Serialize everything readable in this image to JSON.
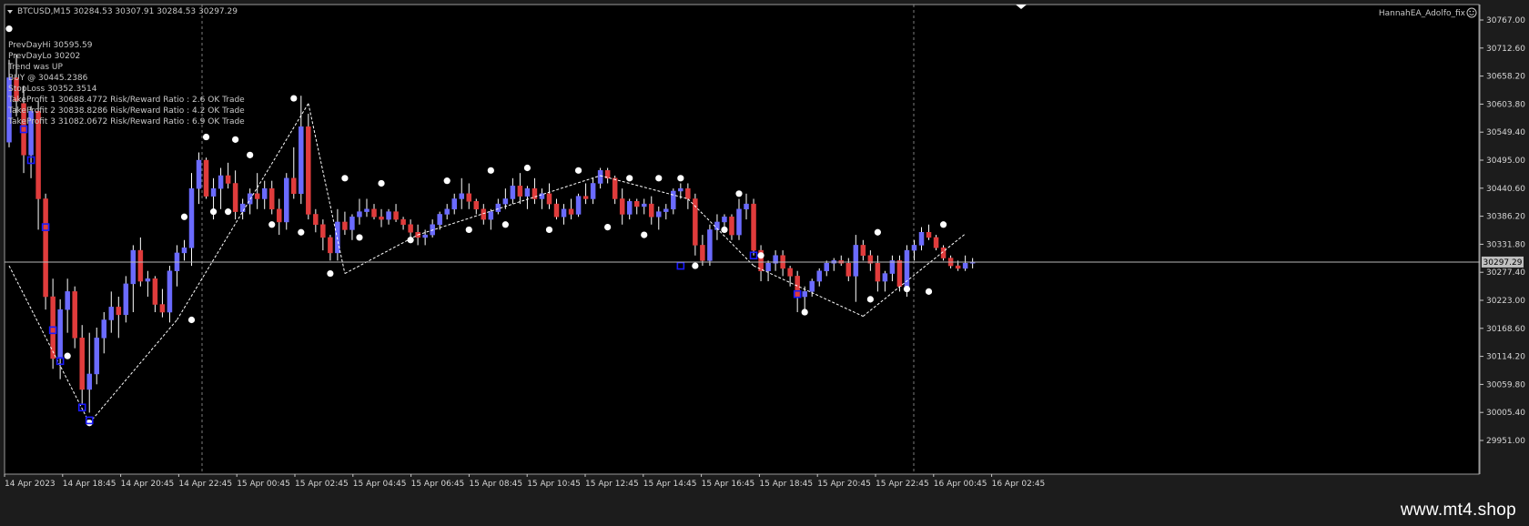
{
  "chart": {
    "symbol_header": "BTCUSD,M15  30284.53 30307.91 30284.53 30297.29",
    "ea_label": "HannahEA_Adolfo_fix",
    "current_price": "30297.29",
    "info_lines": [
      "PrevDayHi 30595.59",
      "PrevDayLo 30202",
      "Trend was UP",
      "BUY @ 30445.2386",
      "StopLoss 30352.3514",
      "TakeProfit 1 30688.4772 Risk/Reward Ratio : 2.6 OK Trade",
      "TakeProfit 2 30838.8286 Risk/Reward Ratio : 4.2 OK Trade",
      "TakeProfit 3 31082.0672 Risk/Reward Ratio : 6.9 OK Trade"
    ],
    "price_ticks": [
      "30767.00",
      "30712.60",
      "30658.20",
      "30603.80",
      "30549.40",
      "30495.00",
      "30440.60",
      "30386.20",
      "30331.80",
      "30277.40",
      "30223.00",
      "30168.60",
      "30114.20",
      "30059.80",
      "30005.40",
      "29951.00"
    ],
    "time_ticks": [
      "14 Apr 2023",
      "14 Apr 18:45",
      "14 Apr 20:45",
      "14 Apr 22:45",
      "15 Apr 00:45",
      "15 Apr 02:45",
      "15 Apr 04:45",
      "15 Apr 06:45",
      "15 Apr 08:45",
      "15 Apr 10:45",
      "15 Apr 12:45",
      "15 Apr 14:45",
      "15 Apr 16:45",
      "15 Apr 18:45",
      "15 Apr 20:45",
      "15 Apr 22:45",
      "16 Apr 00:45",
      "16 Apr 02:45"
    ],
    "colors": {
      "bull": "#6b6bff",
      "bear": "#e03c3c",
      "background": "#000000",
      "grid": "#9a9a9a",
      "zigzag": "#ffffff",
      "marker": "#1a1aff"
    }
  },
  "chart_data": {
    "type": "candlestick",
    "y_range": [
      29951.0,
      30767.0
    ],
    "candles": [
      [
        30530,
        30690,
        30520,
        30655
      ],
      [
        30655,
        30700,
        30580,
        30610
      ],
      [
        30605,
        30640,
        30470,
        30505
      ],
      [
        30505,
        30600,
        30460,
        30590
      ],
      [
        30590,
        30610,
        30360,
        30420
      ],
      [
        30420,
        30430,
        30205,
        30230
      ],
      [
        30230,
        30265,
        30090,
        30110
      ],
      [
        30110,
        30225,
        30070,
        30205
      ],
      [
        30205,
        30265,
        30160,
        30240
      ],
      [
        30240,
        30250,
        30130,
        30150
      ],
      [
        30150,
        30175,
        30020,
        30050
      ],
      [
        30050,
        30160,
        30005,
        30080
      ],
      [
        30080,
        30170,
        30060,
        30150
      ],
      [
        30150,
        30200,
        30120,
        30185
      ],
      [
        30185,
        30240,
        30160,
        30210
      ],
      [
        30210,
        30230,
        30150,
        30195
      ],
      [
        30195,
        30270,
        30180,
        30255
      ],
      [
        30255,
        30330,
        30200,
        30320
      ],
      [
        30320,
        30345,
        30250,
        30260
      ],
      [
        30260,
        30280,
        30230,
        30265
      ],
      [
        30265,
        30270,
        30200,
        30215
      ],
      [
        30215,
        30245,
        30190,
        30200
      ],
      [
        30200,
        30290,
        30180,
        30280
      ],
      [
        30280,
        30330,
        30250,
        30315
      ],
      [
        30315,
        30340,
        30300,
        30325
      ],
      [
        30325,
        30470,
        30290,
        30440
      ],
      [
        30440,
        30510,
        30410,
        30495
      ],
      [
        30495,
        30500,
        30420,
        30425
      ],
      [
        30425,
        30460,
        30380,
        30440
      ],
      [
        30440,
        30480,
        30400,
        30465
      ],
      [
        30465,
        30490,
        30440,
        30450
      ],
      [
        30450,
        30475,
        30380,
        30395
      ],
      [
        30395,
        30420,
        30380,
        30410
      ],
      [
        30410,
        30440,
        30390,
        30430
      ],
      [
        30430,
        30470,
        30400,
        30420
      ],
      [
        30420,
        30455,
        30400,
        30440
      ],
      [
        30440,
        30455,
        30390,
        30400
      ],
      [
        30400,
        30420,
        30350,
        30375
      ],
      [
        30375,
        30470,
        30360,
        30460
      ],
      [
        30460,
        30520,
        30420,
        30430
      ],
      [
        30430,
        30620,
        30410,
        30560
      ],
      [
        30560,
        30585,
        30380,
        30390
      ],
      [
        30390,
        30400,
        30355,
        30370
      ],
      [
        30370,
        30380,
        30320,
        30345
      ],
      [
        30345,
        30350,
        30300,
        30315
      ],
      [
        30315,
        30400,
        30300,
        30375
      ],
      [
        30375,
        30395,
        30350,
        30360
      ],
      [
        30360,
        30390,
        30340,
        30385
      ],
      [
        30385,
        30420,
        30370,
        30395
      ],
      [
        30395,
        30420,
        30385,
        30400
      ],
      [
        30400,
        30410,
        30380,
        30385
      ],
      [
        30385,
        30400,
        30365,
        30380
      ],
      [
        30380,
        30400,
        30370,
        30395
      ],
      [
        30395,
        30410,
        30375,
        30380
      ],
      [
        30380,
        30385,
        30360,
        30370
      ],
      [
        30370,
        30380,
        30340,
        30355
      ],
      [
        30355,
        30370,
        30330,
        30345
      ],
      [
        30345,
        30360,
        30330,
        30350
      ],
      [
        30350,
        30380,
        30345,
        30370
      ],
      [
        30370,
        30395,
        30360,
        30390
      ],
      [
        30390,
        30410,
        30380,
        30400
      ],
      [
        30400,
        30430,
        30390,
        30420
      ],
      [
        30420,
        30460,
        30400,
        30430
      ],
      [
        30430,
        30450,
        30400,
        30415
      ],
      [
        30415,
        30420,
        30390,
        30400
      ],
      [
        30400,
        30410,
        30370,
        30380
      ],
      [
        30380,
        30400,
        30360,
        30395
      ],
      [
        30395,
        30420,
        30390,
        30410
      ],
      [
        30410,
        30440,
        30400,
        30420
      ],
      [
        30420,
        30460,
        30410,
        30445
      ],
      [
        30445,
        30470,
        30410,
        30425
      ],
      [
        30425,
        30445,
        30400,
        30440
      ],
      [
        30440,
        30460,
        30410,
        30420
      ],
      [
        30420,
        30440,
        30400,
        30430
      ],
      [
        30430,
        30450,
        30400,
        30410
      ],
      [
        30410,
        30420,
        30380,
        30385
      ],
      [
        30385,
        30410,
        30370,
        30400
      ],
      [
        30400,
        30420,
        30380,
        30390
      ],
      [
        30390,
        30430,
        30385,
        30425
      ],
      [
        30425,
        30450,
        30410,
        30420
      ],
      [
        30420,
        30460,
        30410,
        30450
      ],
      [
        30450,
        30480,
        30440,
        30475
      ],
      [
        30475,
        30480,
        30450,
        30460
      ],
      [
        30460,
        30465,
        30410,
        30420
      ],
      [
        30420,
        30440,
        30370,
        30390
      ],
      [
        30390,
        30420,
        30380,
        30415
      ],
      [
        30415,
        30420,
        30390,
        30405
      ],
      [
        30405,
        30420,
        30390,
        30410
      ],
      [
        30410,
        30425,
        30370,
        30385
      ],
      [
        30385,
        30405,
        30360,
        30395
      ],
      [
        30395,
        30410,
        30380,
        30400
      ],
      [
        30400,
        30440,
        30390,
        30435
      ],
      [
        30435,
        30450,
        30420,
        30440
      ],
      [
        30440,
        30450,
        30400,
        30420
      ],
      [
        30420,
        30430,
        30310,
        30330
      ],
      [
        30330,
        30350,
        30290,
        30300
      ],
      [
        30300,
        30370,
        30290,
        30360
      ],
      [
        30360,
        30390,
        30340,
        30375
      ],
      [
        30375,
        30390,
        30360,
        30385
      ],
      [
        30385,
        30390,
        30340,
        30350
      ],
      [
        30350,
        30420,
        30340,
        30400
      ],
      [
        30400,
        30430,
        30380,
        30410
      ],
      [
        30410,
        30420,
        30310,
        30320
      ],
      [
        30320,
        30330,
        30260,
        30280
      ],
      [
        30280,
        30300,
        30260,
        30295
      ],
      [
        30295,
        30320,
        30280,
        30310
      ],
      [
        30310,
        30320,
        30270,
        30285
      ],
      [
        30285,
        30290,
        30250,
        30270
      ],
      [
        30270,
        30280,
        30200,
        30230
      ],
      [
        30230,
        30250,
        30195,
        30240
      ],
      [
        30240,
        30265,
        30230,
        30260
      ],
      [
        30260,
        30285,
        30250,
        30280
      ],
      [
        30280,
        30300,
        30270,
        30295
      ],
      [
        30295,
        30305,
        30280,
        30300
      ],
      [
        30300,
        30310,
        30290,
        30295
      ],
      [
        30295,
        30305,
        30260,
        30270
      ],
      [
        30270,
        30350,
        30220,
        30330
      ],
      [
        30330,
        30340,
        30300,
        30310
      ],
      [
        30310,
        30320,
        30280,
        30295
      ],
      [
        30295,
        30310,
        30240,
        30260
      ],
      [
        30260,
        30280,
        30240,
        30275
      ],
      [
        30275,
        30310,
        30260,
        30300
      ],
      [
        30300,
        30310,
        30240,
        30250
      ],
      [
        30250,
        30330,
        30230,
        30320
      ],
      [
        30320,
        30340,
        30300,
        30330
      ],
      [
        30330,
        30365,
        30320,
        30355
      ],
      [
        30355,
        30370,
        30340,
        30345
      ],
      [
        30345,
        30350,
        30320,
        30325
      ],
      [
        30325,
        30330,
        30300,
        30305
      ],
      [
        30305,
        30310,
        30285,
        30290
      ],
      [
        30290,
        30300,
        30280,
        30285
      ],
      [
        30285,
        30310,
        30280,
        30295
      ],
      [
        30295,
        30305,
        30285,
        30297
      ]
    ],
    "zigzag": [
      [
        0,
        30290
      ],
      [
        11,
        29985
      ],
      [
        23,
        30185
      ],
      [
        41,
        30605
      ],
      [
        46,
        30275
      ],
      [
        56,
        30350
      ],
      [
        81,
        30465
      ],
      [
        93,
        30420
      ],
      [
        102,
        30290
      ],
      [
        117,
        30192
      ],
      [
        131,
        30352
      ]
    ],
    "fractals": [
      [
        0,
        30750
      ],
      [
        11,
        29985
      ],
      [
        8,
        30115
      ],
      [
        25,
        30185
      ],
      [
        24,
        30385
      ],
      [
        27,
        30540
      ],
      [
        28,
        30395
      ],
      [
        31,
        30535
      ],
      [
        30,
        30395
      ],
      [
        33,
        30505
      ],
      [
        36,
        30370
      ],
      [
        39,
        30615
      ],
      [
        40,
        30355
      ],
      [
        44,
        30275
      ],
      [
        46,
        30460
      ],
      [
        48,
        30345
      ],
      [
        51,
        30450
      ],
      [
        55,
        30340
      ],
      [
        60,
        30455
      ],
      [
        63,
        30360
      ],
      [
        66,
        30475
      ],
      [
        68,
        30370
      ],
      [
        71,
        30480
      ],
      [
        74,
        30360
      ],
      [
        78,
        30475
      ],
      [
        82,
        30365
      ],
      [
        85,
        30460
      ],
      [
        87,
        30350
      ],
      [
        89,
        30460
      ],
      [
        92,
        30460
      ],
      [
        94,
        30290
      ],
      [
        98,
        30360
      ],
      [
        100,
        30430
      ],
      [
        103,
        30310
      ],
      [
        109,
        30200
      ],
      [
        118,
        30225
      ],
      [
        119,
        30355
      ],
      [
        123,
        30245
      ],
      [
        126,
        30240
      ],
      [
        128,
        30370
      ]
    ],
    "markers": [
      [
        2,
        30555
      ],
      [
        3,
        30495
      ],
      [
        5,
        30365
      ],
      [
        6,
        30165
      ],
      [
        7,
        30105
      ],
      [
        10,
        30015
      ],
      [
        11,
        29990
      ],
      [
        92,
        30290
      ],
      [
        102,
        30310
      ],
      [
        108,
        30235
      ]
    ]
  }
}
